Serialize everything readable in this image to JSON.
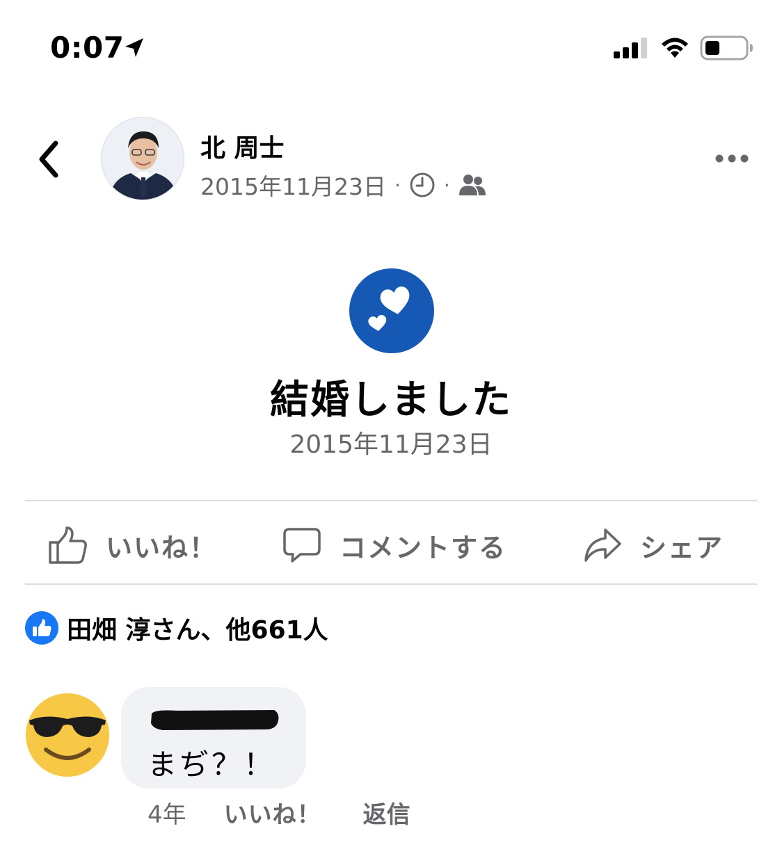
{
  "status_bar": {
    "time": "0:07",
    "icons": [
      "location-arrow-icon",
      "cellular-signal-icon",
      "wifi-icon",
      "battery-icon"
    ]
  },
  "header": {
    "author_name": "北 周士",
    "post_date": "2015年11月23日",
    "separator": "·",
    "icons": [
      "back-chevron-icon",
      "clock-icon",
      "friends-icon",
      "more-dots-icon"
    ]
  },
  "life_event": {
    "icon": "hearts-icon",
    "title": "結婚しました",
    "date": "2015年11月23日",
    "icon_color": "#1559b5"
  },
  "actions": {
    "like_label": "いいね！",
    "comment_label": "コメントする",
    "share_label": "シェア"
  },
  "reactions": {
    "summary": "田畑 淳さん、他661人",
    "badge_color": "#1877f2"
  },
  "comment": {
    "text": "まぢ？！",
    "time": "4年",
    "like_label": "いいね！",
    "reply_label": "返信"
  }
}
